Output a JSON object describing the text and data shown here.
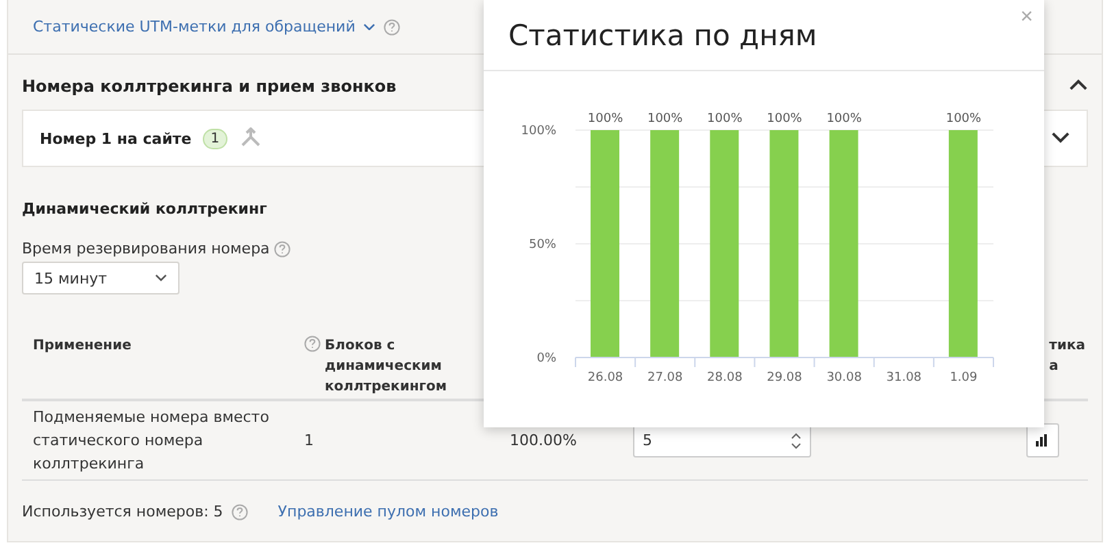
{
  "utm_link": {
    "label": "Статические UTM-метки для обращений"
  },
  "section": {
    "title": "Номера коллтрекинга и прием звонков",
    "expanded": true
  },
  "number_card": {
    "title": "Номер 1 на сайте",
    "badge": "1",
    "expanded": false
  },
  "dynamic": {
    "title": "Динамический коллтрекинг",
    "reserve_label": "Время резервирования номера",
    "reserve_value": "15 минут"
  },
  "table": {
    "columns": [
      {
        "label": "Применение",
        "help": false
      },
      {
        "label": "Блоков с динамическим коллтрекингом",
        "help": true
      },
      {
        "label": "тика\nа",
        "help": false
      }
    ],
    "rows": [
      {
        "usage": "Подменяемые номера вместо статического номера коллтрекинга",
        "blocks": "1",
        "share": "100.00%",
        "count": "5"
      }
    ]
  },
  "footer": {
    "used": "Используется номеров: 5",
    "link": "Управление пулом номеров"
  },
  "popup": {
    "title": "Статистика по дням",
    "close": "×",
    "chart_data": {
      "type": "bar",
      "categories": [
        "26.08",
        "27.08",
        "28.08",
        "29.08",
        "30.08",
        "31.08",
        "1.09"
      ],
      "values": [
        100,
        100,
        100,
        100,
        100,
        null,
        100
      ],
      "ylim": [
        0,
        100
      ],
      "yticks": [
        {
          "value": 0,
          "label": "0%"
        },
        {
          "value": 50,
          "label": "50%"
        },
        {
          "value": 100,
          "label": "100%"
        }
      ],
      "data_labels": true,
      "value_labels": [
        "100%",
        "100%",
        "100%",
        "100%",
        "100%",
        null,
        "100%"
      ],
      "color": "#86d04e"
    }
  }
}
